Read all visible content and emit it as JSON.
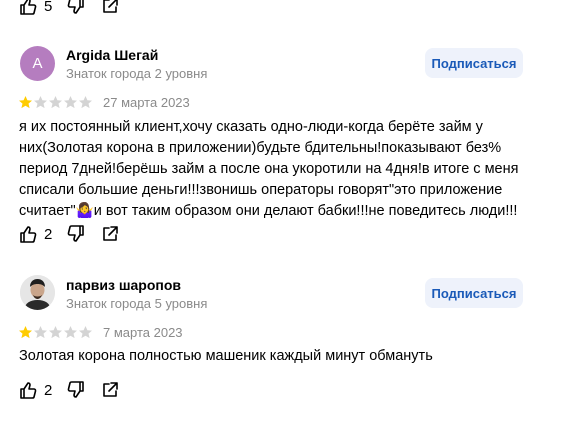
{
  "top_actions": {
    "like_count": "5"
  },
  "reviews": [
    {
      "avatar_letter": "A",
      "name": "Argida Шегай",
      "level": "Знаток города 2 уровня",
      "subscribe_label": "Подписаться",
      "rating": 1,
      "date": "27 марта 2023",
      "text": "я их постоянный клиент,хочу сказать одно-люди-когда берёте займ у них(Золотая корона в приложении)будьте бдительны!показывают без% период 7дней!берёшь займ а после она укоротили на 4дня!в итоге с меня списали большие деньги!!!звонишь операторы говорят\"это приложение считает\"🤷‍♀️и вот таким образом они делают бабки!!!не поведитесь люди!!!",
      "like_count": "2"
    },
    {
      "name": "парвиз шаропов",
      "level": "Знаток города 5 уровня",
      "subscribe_label": "Подписаться",
      "rating": 1,
      "date": "7 марта 2023",
      "text": "Золотая корона полностью машеник каждый минут обмануть",
      "like_count": "2"
    }
  ],
  "colors": {
    "accent": "#1a5ab8",
    "star_active": "#fc0",
    "star_inactive": "#d4d4d4"
  }
}
